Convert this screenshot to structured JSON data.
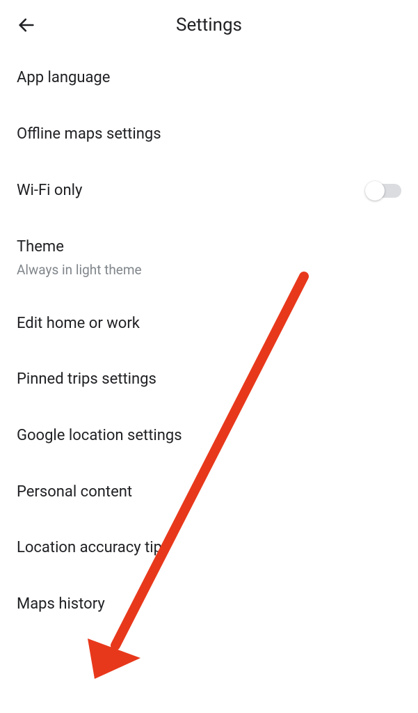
{
  "header": {
    "title": "Settings"
  },
  "settings": {
    "items": [
      {
        "label": "App language"
      },
      {
        "label": "Offline maps settings"
      },
      {
        "label": "Wi-Fi only",
        "has_toggle": true,
        "toggle_on": false
      },
      {
        "label": "Theme",
        "sublabel": "Always in light theme"
      },
      {
        "label": "Edit home or work"
      },
      {
        "label": "Pinned trips settings"
      },
      {
        "label": "Google location settings"
      },
      {
        "label": "Personal content"
      },
      {
        "label": "Location accuracy tips"
      },
      {
        "label": "Maps history"
      }
    ]
  },
  "annotation": {
    "arrow_color": "#e8381b"
  }
}
